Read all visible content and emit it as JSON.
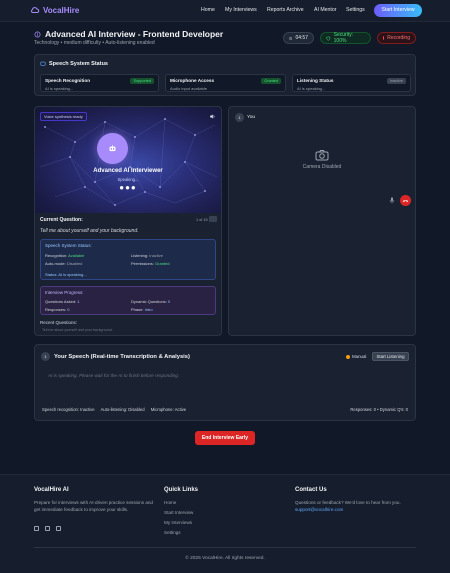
{
  "brand": {
    "name": "VocalHire",
    "accent": "#a78bfa"
  },
  "nav": {
    "links": [
      "Home",
      "My Interviews",
      "Reports Archive",
      "AI Mentor",
      "Settings"
    ],
    "cta": "Start Interview"
  },
  "header": {
    "title": "Advanced AI Interview - Frontend Developer",
    "subtitle": "Technology • medium difficulty • Auto-listening enabled",
    "timer": "04:57",
    "security": "Security: 100%",
    "recording": "Recording"
  },
  "speech_status": {
    "title": "Speech System Status",
    "cards": [
      {
        "title": "Speech Recognition",
        "sub": "AI is speaking...",
        "badge": "Supported",
        "badge_color": "#4ade80"
      },
      {
        "title": "Microphone Access",
        "sub": "Audio input available",
        "badge": "Granted",
        "badge_color": "#4ade80"
      },
      {
        "title": "Listening Status",
        "sub": "AI is speaking...",
        "badge": "Inactive",
        "badge_color": "#9ca3af"
      }
    ]
  },
  "ai_panel": {
    "tag": "Voice synthesis ready",
    "name": "Advanced AI Interviewer",
    "state": "Speaking...",
    "dots": "●●●",
    "question_label": "Current Question:",
    "question_count": "1 of 15",
    "question_text": "Tell me about yourself and your background.",
    "system_box": {
      "title": "Speech System Status:",
      "recognition_label": "Recognition:",
      "recognition_value": "Available",
      "listening_label": "Listening:",
      "listening_value": "Inactive",
      "automode_label": "Auto-mode:",
      "automode_value": "Disabled",
      "permissions_label": "Permissions:",
      "permissions_value": "Granted",
      "status": "Status: AI is speaking..."
    },
    "progress_box": {
      "title": "Interview Progress:",
      "asked_label": "Questions Asked:",
      "asked_value": "1",
      "dynamic_label": "Dynamic Questions:",
      "dynamic_value": "0",
      "responses_label": "Responses:",
      "responses_value": "0",
      "phase_label": "Phase:",
      "phase_value": "Intro"
    },
    "recent_label": "Recent Questions:",
    "recent_item": "Tell me about yourself and your background."
  },
  "user_panel": {
    "badge_num": "1",
    "badge_label": "You",
    "camera_text": "Camera Disabled"
  },
  "transcript": {
    "num": "1",
    "title": "Your Speech (Real-time Transcription & Analysis)",
    "mode": "Manual",
    "button": "Start Listening",
    "message": "AI is speaking. Please wait for the AI to finish before responding.",
    "footer_items": [
      "Speech recognition: Inactive",
      "Auto-listening: Disabled",
      "Microphone: Active"
    ],
    "footer_right": "Responses: 0 • Dynamic Q's: 0"
  },
  "end_button": "End Interview Early",
  "footer": {
    "about_title": "VocalHire AI",
    "about_text": "Prepare for interviews with AI-driven practice sessions and get immediate feedback to improve your skills.",
    "links_title": "Quick Links",
    "links": [
      "Home",
      "Start Interview",
      "My Interviews",
      "Settings"
    ],
    "contact_title": "Contact Us",
    "contact_text": "Questions or feedback? We'd love to hear from you.",
    "email": "support@vocalhire.com",
    "copyright": "© 2025 VocalHire. All rights reserved."
  }
}
